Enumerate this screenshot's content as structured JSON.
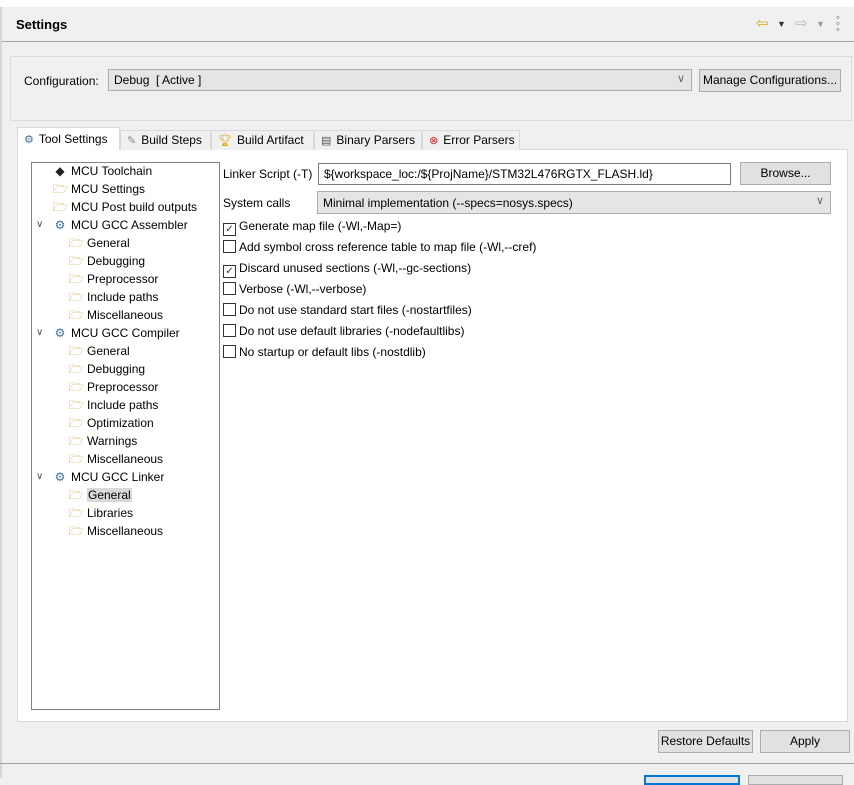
{
  "header": {
    "title": "Settings",
    "back_icon": "back-arrow-icon",
    "forward_icon": "forward-arrow-icon",
    "menu_icon": "view-menu-icon"
  },
  "configuration": {
    "label": "Configuration:",
    "value": "Debug  [ Active ]",
    "manage_label": "Manage Configurations..."
  },
  "tabs": [
    {
      "label": "Tool Settings",
      "icon": "tool-settings-icon"
    },
    {
      "label": "Build Steps",
      "icon": "build-steps-icon"
    },
    {
      "label": "Build Artifact",
      "icon": "build-artifact-icon"
    },
    {
      "label": "Binary Parsers",
      "icon": "binary-parsers-icon"
    },
    {
      "label": "Error Parsers",
      "icon": "error-parsers-icon"
    }
  ],
  "tree": [
    {
      "label": "MCU Toolchain",
      "level": 0,
      "icon": "chip"
    },
    {
      "label": "MCU Settings",
      "level": 0,
      "icon": "folder"
    },
    {
      "label": "MCU Post build outputs",
      "level": 0,
      "icon": "folder"
    },
    {
      "label": "MCU GCC Assembler",
      "level": 0,
      "icon": "gear",
      "expanded": true
    },
    {
      "label": "General",
      "level": 1,
      "icon": "folder"
    },
    {
      "label": "Debugging",
      "level": 1,
      "icon": "folder"
    },
    {
      "label": "Preprocessor",
      "level": 1,
      "icon": "folder"
    },
    {
      "label": "Include paths",
      "level": 1,
      "icon": "folder"
    },
    {
      "label": "Miscellaneous",
      "level": 1,
      "icon": "folder"
    },
    {
      "label": "MCU GCC Compiler",
      "level": 0,
      "icon": "gear",
      "expanded": true
    },
    {
      "label": "General",
      "level": 1,
      "icon": "folder"
    },
    {
      "label": "Debugging",
      "level": 1,
      "icon": "folder"
    },
    {
      "label": "Preprocessor",
      "level": 1,
      "icon": "folder"
    },
    {
      "label": "Include paths",
      "level": 1,
      "icon": "folder"
    },
    {
      "label": "Optimization",
      "level": 1,
      "icon": "folder"
    },
    {
      "label": "Warnings",
      "level": 1,
      "icon": "folder"
    },
    {
      "label": "Miscellaneous",
      "level": 1,
      "icon": "folder"
    },
    {
      "label": "MCU GCC Linker",
      "level": 0,
      "icon": "gear",
      "expanded": true
    },
    {
      "label": "General",
      "level": 1,
      "icon": "folder",
      "selected": true
    },
    {
      "label": "Libraries",
      "level": 1,
      "icon": "folder"
    },
    {
      "label": "Miscellaneous",
      "level": 1,
      "icon": "folder"
    }
  ],
  "linker": {
    "script_label": "Linker Script (-T)",
    "script_value": "${workspace_loc:/${ProjName}/STM32L476RGTX_FLASH.ld}",
    "browse_label": "Browse...",
    "syscalls_label": "System calls",
    "syscalls_value": "Minimal implementation (--specs=nosys.specs)",
    "options": [
      {
        "label": "Generate map file (-Wl,-Map=)",
        "checked": true
      },
      {
        "label": "Add symbol cross reference table to map file (-Wl,--cref)",
        "checked": false
      },
      {
        "label": "Discard unused sections (-Wl,--gc-sections)",
        "checked": true
      },
      {
        "label": "Verbose (-Wl,--verbose)",
        "checked": false
      },
      {
        "label": "Do not use standard start files (-nostartfiles)",
        "checked": false
      },
      {
        "label": "Do not use default libraries (-nodefaultlibs)",
        "checked": false
      },
      {
        "label": "No startup or default libs (-nostdlib)",
        "checked": false
      }
    ]
  },
  "footer": {
    "restore_label": "Restore Defaults",
    "apply_label": "Apply"
  }
}
